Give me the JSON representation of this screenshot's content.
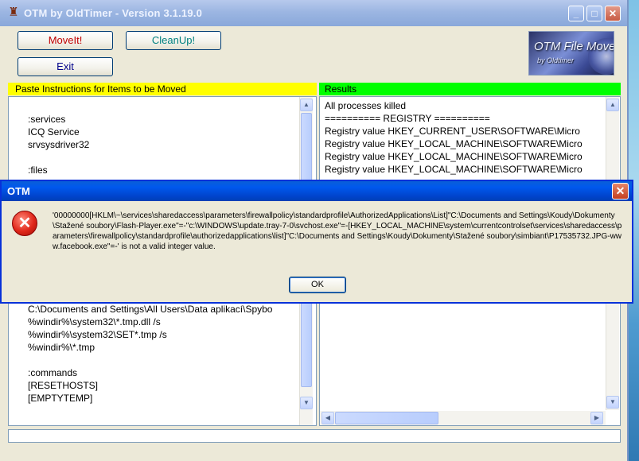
{
  "main_window": {
    "title": "OTM by OldTimer - Version 3.1.19.0",
    "buttons": {
      "moveit": "MoveIt!",
      "cleanup": "CleanUp!",
      "exit": "Exit"
    },
    "logo": {
      "line1": "OTM File Mover",
      "line2": "by Oldtimer"
    },
    "instructions_panel": {
      "header": "Paste Instructions for Items to be Moved",
      "lines_top": ":services\nICQ Service\nsrvsysdriver32\n\n:files",
      "lines_bottom": "C:\\Documents and Settings\\All Users\\Data aplikací\\Spybo\n%windir%\\system32\\*.tmp.dll /s\n%windir%\\system32\\SET*.tmp /s\n%windir%\\*.tmp\n\n:commands\n[RESETHOSTS]\n[EMPTYTEMP]"
    },
    "results_panel": {
      "header": "Results",
      "lines": "All processes killed\n========== REGISTRY ==========\nRegistry value HKEY_CURRENT_USER\\SOFTWARE\\Micro\nRegistry value HKEY_LOCAL_MACHINE\\SOFTWARE\\Micro\nRegistry value HKEY_LOCAL_MACHINE\\SOFTWARE\\Micro\nRegistry value HKEY_LOCAL_MACHINE\\SOFTWARE\\Micro"
    },
    "colors": {
      "instructions_header_bg": "#ffff00",
      "results_header_bg": "#00ff00",
      "moveit_text": "#c00000",
      "cleanup_text": "#008080",
      "exit_text": "#00008b"
    }
  },
  "dialog": {
    "title": "OTM",
    "message": "'00000000[HKLM\\~\\services\\sharedaccess\\parameters\\firewallpolicy\\standardprofile\\AuthorizedApplications\\List]\"C:\\Documents and Settings\\Koudy\\Dokumenty\\Stažené soubory\\Flash-Player.exe\"=-\"c:\\WINDOWS\\update.tray-7-0\\svchost.exe\"=-[HKEY_LOCAL_MACHINE\\system\\currentcontrolset\\services\\sharedaccess\\parameters\\firewallpolicy\\standardprofile\\authorizedapplications\\list]\"C:\\Documents and Settings\\Koudy\\Dokumenty\\Stažené soubory\\simbiant\\P17535732.JPG-www.facebook.exe\"=-' is not a valid integer value.",
    "ok_label": "OK",
    "icon": "error-icon"
  }
}
